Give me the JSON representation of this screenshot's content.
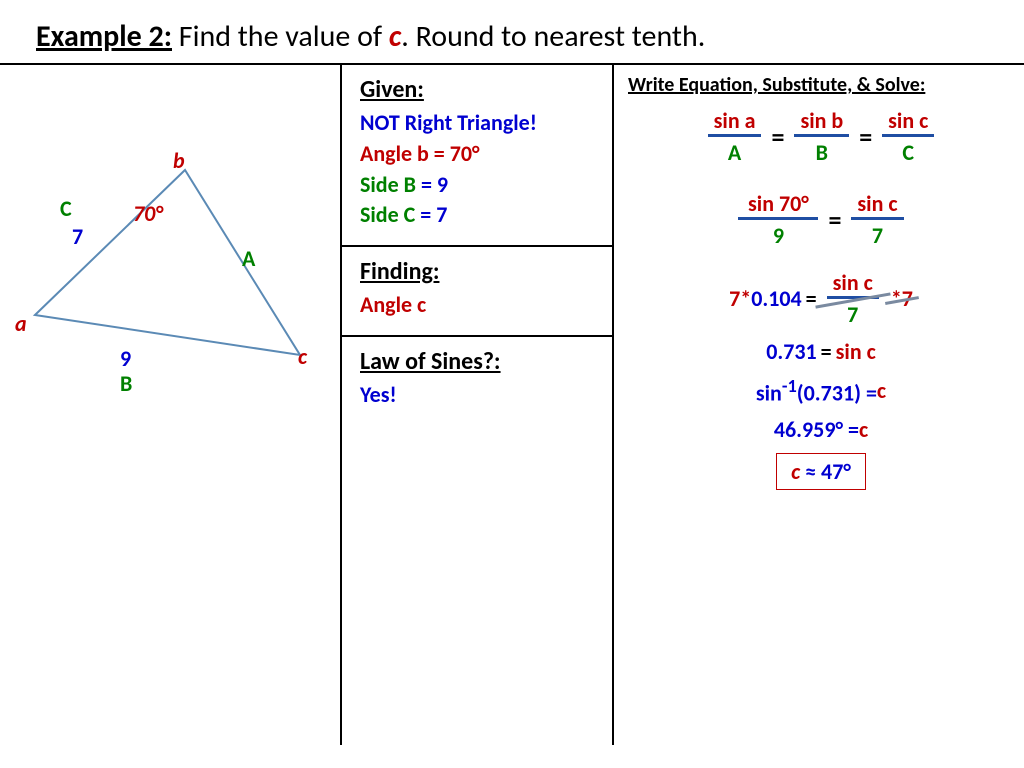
{
  "title": {
    "prefix": "Example 2:",
    "body1": " Find the value of ",
    "var": "c",
    "body2": ". Round to nearest tenth."
  },
  "diagram": {
    "vertex_b": "b",
    "vertex_a": "a",
    "vertex_c": "c",
    "side_A": "A",
    "side_B": "B",
    "side_C": "C",
    "len_C": "7",
    "len_B": "9",
    "angle_b": "70°"
  },
  "given": {
    "hd": "Given:",
    "l1": "NOT Right Triangle!",
    "l2": "Angle b = 70°",
    "l3a": "Side B",
    "l3b": " = 9",
    "l4a": "Side C",
    "l4b": " = 7"
  },
  "finding": {
    "hd": "Finding:",
    "l1": "Angle c"
  },
  "law": {
    "hd": "Law of Sines?:",
    "l1": "Yes!"
  },
  "work": {
    "hd": "Write Equation, Substitute, & Solve:",
    "f": {
      "sa": "sin a",
      "sb": "sin b",
      "sc": "sin c",
      "A": "A",
      "B": "B",
      "C": "C"
    },
    "s1": {
      "t1": "sin 70°",
      "b1": "9",
      "t2": "sin c",
      "b2": "7"
    },
    "s2": {
      "l": "7*",
      "m": "0.104",
      "eq": "=",
      "t": "sin c",
      "b": "7",
      "r": "*7"
    },
    "s3": {
      "a": "0.731",
      "eq": "=",
      "b": "sin c"
    },
    "s4": {
      "a1": "sin",
      "sup": "-1",
      "a2": "(0.731) = ",
      "b": "c"
    },
    "s5": {
      "a": "46.959° = ",
      "b": "c"
    },
    "ans": {
      "a": "c  ≈   47°"
    }
  }
}
